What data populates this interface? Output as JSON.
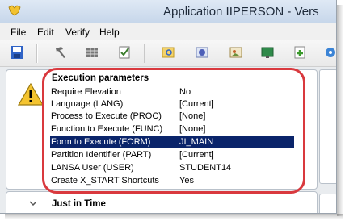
{
  "window": {
    "title": "Application IIPERSON - Vers"
  },
  "menu": [
    {
      "key": "file",
      "label": "File"
    },
    {
      "key": "edit",
      "label": "Edit"
    },
    {
      "key": "verify",
      "label": "Verify"
    },
    {
      "key": "help",
      "label": "Help"
    }
  ],
  "toolbar": {
    "icons": [
      "save-icon",
      "hammer-icon",
      "grid-icon",
      "checklist-icon",
      "open-folder-icon",
      "gear-icon",
      "image-icon",
      "monitor-icon",
      "add-icon",
      "settings-icon"
    ]
  },
  "execution": {
    "heading": "Execution parameters",
    "rows": [
      {
        "key": "Require Elevation",
        "value": "No"
      },
      {
        "key": "Language (LANG)",
        "value": "[Current]"
      },
      {
        "key": "Process to Execute (PROC)",
        "value": "[None]"
      },
      {
        "key": "Function to Execute (FUNC)",
        "value": "[None]"
      },
      {
        "key": "Form to Execute (FORM)",
        "value": "JI_MAIN"
      },
      {
        "key": "Partition Identifier (PART)",
        "value": "[Current]"
      },
      {
        "key": "LANSA User (USER)",
        "value": "STUDENT14"
      },
      {
        "key": "Create X_START Shortcuts",
        "value": "Yes"
      }
    ],
    "selected_index": 4
  },
  "jit": {
    "heading": "Just in Time"
  },
  "colors": {
    "selection": "#0a246a",
    "highlight_outline": "#d9393e",
    "warning": "#f4c430"
  }
}
